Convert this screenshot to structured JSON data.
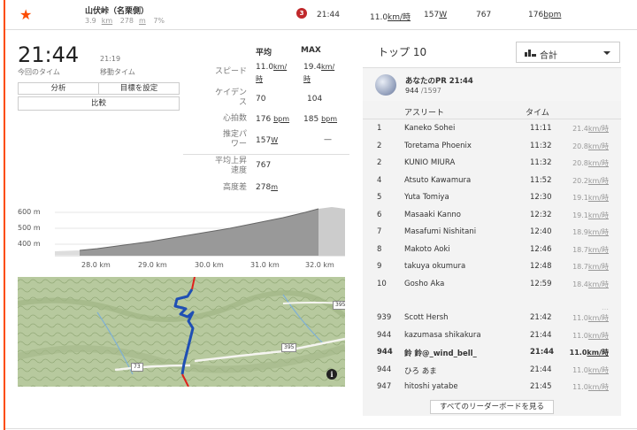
{
  "segment": {
    "name": "山伏峠（名栗側）",
    "distance": "3.9",
    "distance_unit": "km",
    "elev_gain": "278",
    "elev_unit": "m",
    "grade": "7%",
    "rank": "3",
    "time": "21:44",
    "speed": "11.0",
    "speed_unit": "km/時",
    "power": "157",
    "power_unit": "W",
    "heart": "767",
    "dist2": "176",
    "dist2_unit": "bpm"
  },
  "effort": {
    "elapsed_time": "21:44",
    "elapsed_label": "今回のタイム",
    "moving_time": "21:19",
    "moving_label": "移動タイム",
    "btn_analysis": "分析",
    "btn_goal": "目標を設定",
    "btn_compare": "比較"
  },
  "stats": {
    "head_avg": "平均",
    "head_max": "MAX",
    "speed_label": "スピード",
    "speed_avg": "11.0",
    "speed_max": "19.4",
    "speed_unit_a": "km/",
    "speed_unit_b": "時",
    "cadence_label_a": "ケイデン",
    "cadence_label_b": "ス",
    "cadence_avg": "70",
    "cadence_max": "104",
    "hr_label": "心拍数",
    "hr_avg": "176",
    "hr_max": "185",
    "hr_unit": "bpm",
    "power_label_a": "推定パ",
    "power_label_b": "ワー",
    "power_avg": "157",
    "power_unit": "W",
    "power_max": "—",
    "vam_label_a": "平均上昇",
    "vam_label_b": "速度",
    "vam_val": "767",
    "elev_label": "高度差",
    "elev_val": "278",
    "elev_unit": "m"
  },
  "elevation_chart": {
    "y_ticks": [
      "600 m",
      "500 m",
      "400 m"
    ],
    "x_ticks": [
      "28.0 km",
      "29.0 km",
      "30.0 km",
      "31.0 km",
      "32.0 km"
    ]
  },
  "map": {
    "shield_395a": "395",
    "shield_395b": "395",
    "shield_73": "73",
    "info": "i"
  },
  "leaderboard": {
    "title": "トップ 10",
    "filter": "合計",
    "pr_title": "あなたのPR 21:44",
    "pr_rank": "944",
    "pr_total": "/1597",
    "col_athlete": "アスリート",
    "col_time": "タイム",
    "speed_unit": "km/時",
    "rows": [
      {
        "rank": "1",
        "name": "Kaneko Sohei",
        "time": "11:11",
        "speed": "21.4"
      },
      {
        "rank": "2",
        "name": "Toretama Phoenix",
        "time": "11:32",
        "speed": "20.8"
      },
      {
        "rank": "2",
        "name": "KUNIO MIURA",
        "time": "11:32",
        "speed": "20.8"
      },
      {
        "rank": "4",
        "name": "Atsuto Kawamura",
        "time": "11:52",
        "speed": "20.2"
      },
      {
        "rank": "5",
        "name": "Yuta Tomiya",
        "time": "12:30",
        "speed": "19.1"
      },
      {
        "rank": "6",
        "name": "Masaaki Kanno",
        "time": "12:32",
        "speed": "19.1"
      },
      {
        "rank": "7",
        "name": "Masafumi Nishitani",
        "time": "12:40",
        "speed": "18.9"
      },
      {
        "rank": "8",
        "name": "Makoto Aoki",
        "time": "12:46",
        "speed": "18.7"
      },
      {
        "rank": "9",
        "name": "takuya okumura",
        "time": "12:48",
        "speed": "18.7"
      },
      {
        "rank": "10",
        "name": "Gosho Aka",
        "time": "12:59",
        "speed": "18.4"
      }
    ],
    "gap": "…",
    "near_rows": [
      {
        "rank": "939",
        "name": "Scott Hersh",
        "time": "21:42",
        "speed": "11.0"
      },
      {
        "rank": "944",
        "name": "kazumasa shikakura",
        "time": "21:44",
        "speed": "11.0"
      },
      {
        "rank": "944",
        "name": "鈴 鈴@_wind_bell_",
        "time": "21:44",
        "speed": "11.0"
      },
      {
        "rank": "944",
        "name": "ひろ あま",
        "time": "21:44",
        "speed": "11.0"
      },
      {
        "rank": "947",
        "name": "hitoshi yatabe",
        "time": "21:45",
        "speed": "11.0"
      }
    ],
    "see_all": "すべてのリーダーボードを見る"
  }
}
